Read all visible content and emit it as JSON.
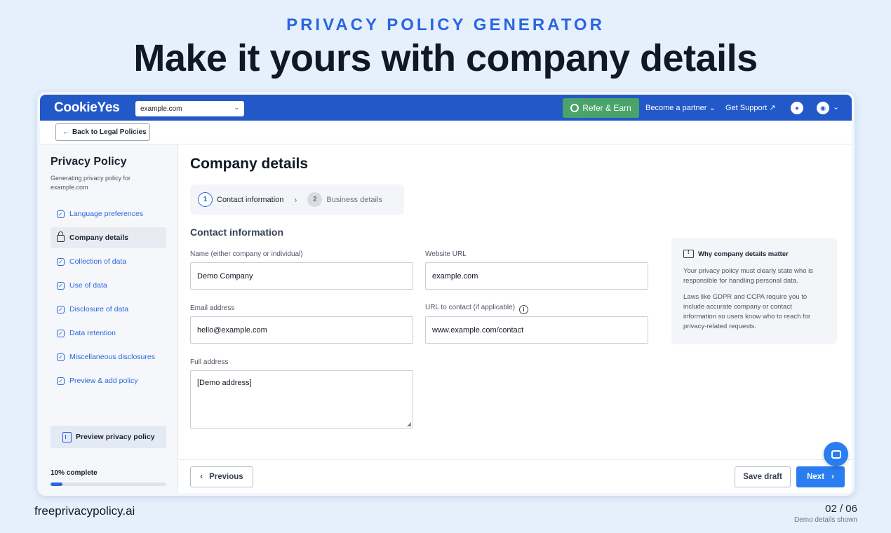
{
  "slide": {
    "eyebrow": "PRIVACY POLICY GENERATOR",
    "headline": "Make it yours with company details",
    "brand": "freeprivacypolicy.ai",
    "page_counter": "02 / 06",
    "note": "Demo details shown"
  },
  "app": {
    "logo": "CookieYes",
    "site_select": "example.com",
    "refer_button": "Refer & Earn",
    "partner_link": "Become a partner",
    "support_link": "Get Support",
    "back_button": "Back to Legal Policies",
    "accent_color": "#2358c8",
    "refer_color": "#4aa36a",
    "next_color": "#2a7df0"
  },
  "sidebar": {
    "title": "Privacy Policy",
    "subtitle": "Generating privacy policy for example.com",
    "items": [
      {
        "label": "Language preferences",
        "state": "done"
      },
      {
        "label": "Company details",
        "state": "active"
      },
      {
        "label": "Collection of data",
        "state": "done"
      },
      {
        "label": "Use of data",
        "state": "done"
      },
      {
        "label": "Disclosure of data",
        "state": "done"
      },
      {
        "label": "Data retention",
        "state": "done"
      },
      {
        "label": "Miscellaneous disclosures",
        "state": "done"
      },
      {
        "label": "Preview & add policy",
        "state": "done"
      }
    ],
    "preview_button": "Preview privacy policy",
    "progress_label": "10% complete",
    "progress_value": 0.1
  },
  "main": {
    "title": "Company details",
    "steps": [
      {
        "num": "1",
        "label": "Contact information",
        "state": "current"
      },
      {
        "num": "2",
        "label": "Business details",
        "state": "upcoming"
      }
    ],
    "section_title": "Contact information",
    "fields": {
      "name": {
        "label": "Name (either company or individual)",
        "value": "Demo Company"
      },
      "website": {
        "label": "Website URL",
        "value": "example.com"
      },
      "email": {
        "label": "Email address",
        "value": "hello@example.com"
      },
      "contact_url": {
        "label": "URL to contact (if applicable)",
        "value": "www.example.com/contact"
      },
      "address": {
        "label": "Full address",
        "value": "[Demo address]"
      }
    },
    "info_card": {
      "title": "Why company details matter",
      "p1": "Your privacy policy must clearly state who is responsible for handling personal data.",
      "p2": "Laws like GDPR and CCPA require you to include accurate company or contact information so users know who to reach for privacy-related requests."
    },
    "buttons": {
      "previous": "Previous",
      "save_draft": "Save draft",
      "next": "Next"
    }
  }
}
